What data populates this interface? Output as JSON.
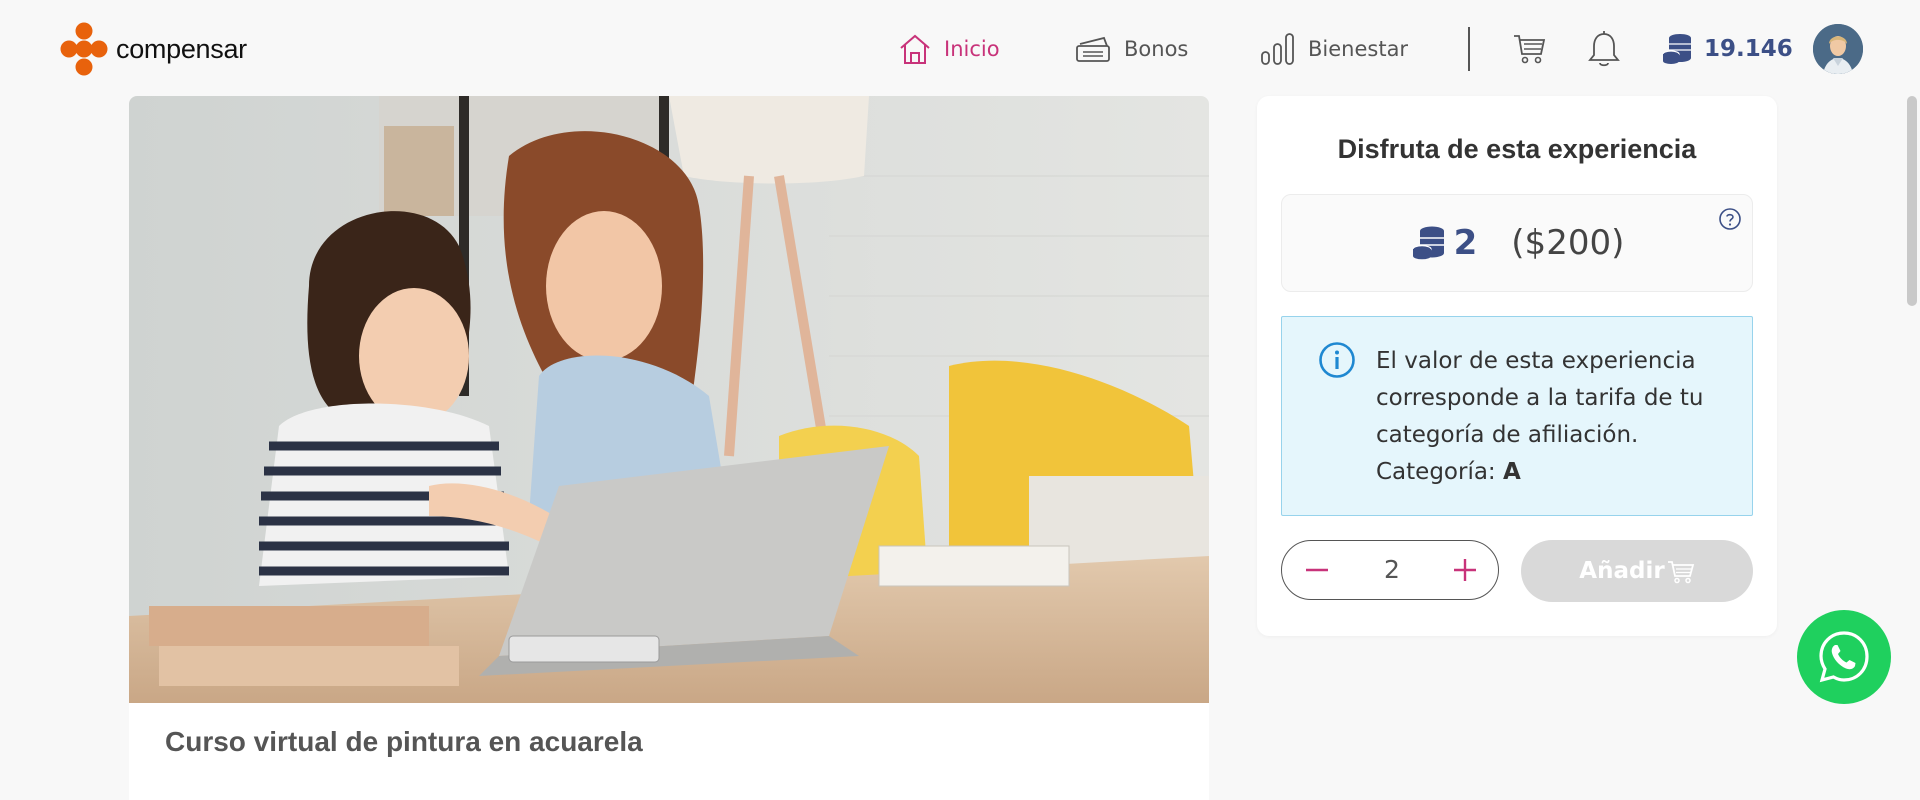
{
  "header": {
    "logo_text": "compensar",
    "nav": [
      {
        "label": "Inicio",
        "active": true
      },
      {
        "label": "Bonos",
        "active": false
      },
      {
        "label": "Bienestar",
        "active": false
      }
    ],
    "points": "19.146"
  },
  "colors": {
    "accent": "#c8337a",
    "points_blue": "#3c4f86",
    "logo_orange": "#e8620c",
    "info_bg": "#e5f6fc",
    "whatsapp_green": "#1fd05e"
  },
  "main": {
    "course_title": "Curso virtual de pintura en acuarela"
  },
  "side": {
    "title": "Disfruta de esta experiencia",
    "price_coins": "2",
    "price_money": "($200)",
    "info_text": "El valor de esta experiencia corresponde a la tarifa de tu categoría de afiliación.",
    "category_label": "Categoría:",
    "category_value": "A",
    "quantity": "2",
    "add_label": "Añadir"
  },
  "icons": [
    "home-icon",
    "ticket-icon",
    "bars-chart-icon",
    "cart-icon",
    "bell-icon",
    "coins-icon",
    "help-icon",
    "info-icon",
    "minus-icon",
    "plus-icon",
    "whatsapp-icon"
  ]
}
